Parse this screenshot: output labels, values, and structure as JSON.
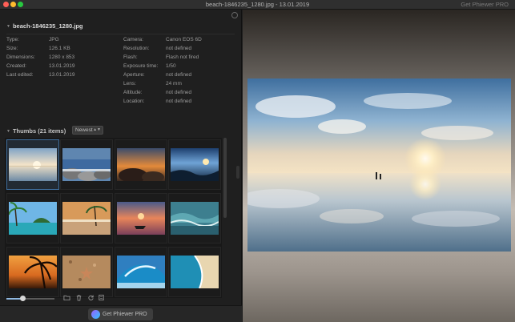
{
  "window": {
    "title": "beach-1846235_1280.jpg - 13.01.2019",
    "pro_label": "Get Phiewer PRO"
  },
  "file": {
    "name": "beach-1846235_1280.jpg"
  },
  "info_left": [
    {
      "key": "Type:",
      "value": "JPG"
    },
    {
      "key": "Size:",
      "value": "126.1 KB"
    },
    {
      "key": "Dimensions:",
      "value": "1280 x 853"
    },
    {
      "key": "Created:",
      "value": "13.01.2019"
    },
    {
      "key": "Last edited:",
      "value": "13.01.2019"
    }
  ],
  "info_right": [
    {
      "key": "Camera:",
      "value": "Canon EOS 6D"
    },
    {
      "key": "Resolution:",
      "value": "not defined"
    },
    {
      "key": "Flash:",
      "value": "Flash not fired"
    },
    {
      "key": "Exposure time:",
      "value": "1/50"
    },
    {
      "key": "Aperture:",
      "value": "not defined"
    },
    {
      "key": "Lens:",
      "value": "24 mm"
    },
    {
      "key": "Altitude:",
      "value": "not defined"
    },
    {
      "key": "Location:",
      "value": "not defined"
    }
  ],
  "thumbs": {
    "header": "Thumbs (21 items)",
    "sort_value": "Newest",
    "items": [
      {
        "kind": "sunset-reflection"
      },
      {
        "kind": "rocky-coast"
      },
      {
        "kind": "rocks-sunset"
      },
      {
        "kind": "blue-coast-sunset"
      },
      {
        "kind": "tropical-palm-island"
      },
      {
        "kind": "palm-beach"
      },
      {
        "kind": "boat-sunset"
      },
      {
        "kind": "sea-waves"
      },
      {
        "kind": "palm-silhouette-sunset"
      },
      {
        "kind": "sand-starfish"
      },
      {
        "kind": "breaking-wave"
      },
      {
        "kind": "aerial-beach"
      }
    ]
  },
  "toolbar": {
    "zoom_level": 0.33,
    "icons": [
      "folder-icon",
      "trash-icon",
      "rotate-icon",
      "copy-icon"
    ]
  },
  "footer": {
    "pro_button": "Get Phiewer PRO"
  },
  "colors": {
    "accent": "#3f6e9e",
    "panel": "#1f1f1f",
    "pro_logo_start": "#9b5cff",
    "pro_logo_end": "#2fc6ff"
  }
}
